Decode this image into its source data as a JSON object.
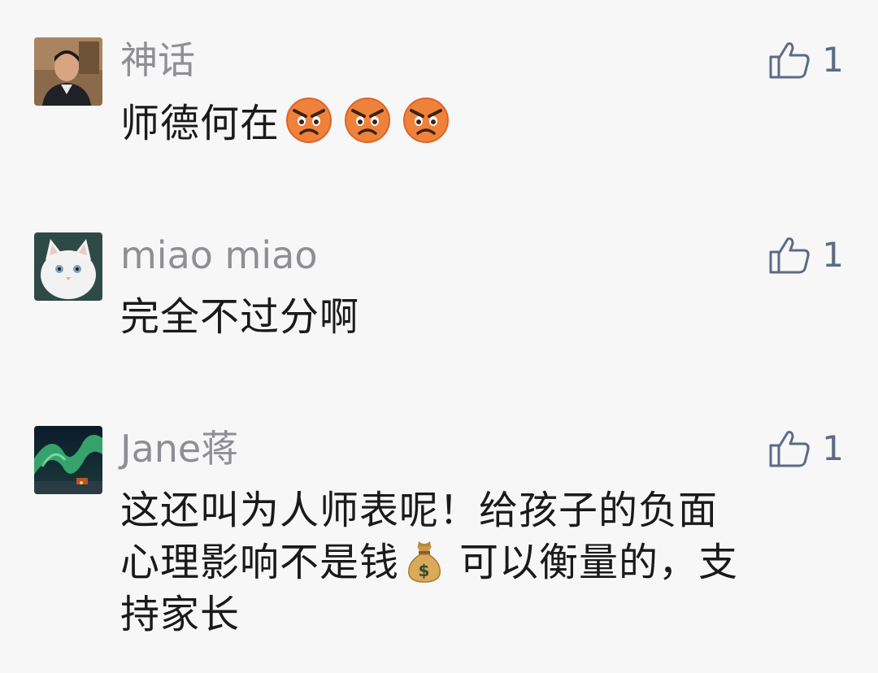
{
  "comments": [
    {
      "name": "神话",
      "likes": "1",
      "text": "师德何在",
      "emojis": [
        "angry-face",
        "angry-face",
        "angry-face"
      ]
    },
    {
      "name": "miao miao",
      "likes": "1",
      "text": "完全不过分啊"
    },
    {
      "name": "Jane蒋",
      "likes": "1",
      "text_line1": "这还叫为人师表呢！给孩子的负面",
      "text_line2a": "心理影响不是钱",
      "text_line2b": "可以衡量的，支",
      "text_line3": "持家长",
      "emoji": "money-bag"
    }
  ],
  "colors": {
    "background": "#f7f7f7",
    "name": "#8e8e93",
    "text": "#1a1a1a",
    "like": "#5c6a86",
    "emoji_face": "#f0813a"
  }
}
